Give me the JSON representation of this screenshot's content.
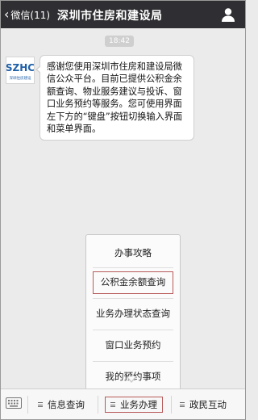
{
  "header": {
    "back_label": "微信(11)",
    "title": "深圳市住房和建设局"
  },
  "chat": {
    "timestamp": "18:42",
    "avatar_logo_text": "SZHC",
    "avatar_sub_text": "深圳住房建设",
    "message": "感谢您使用深圳市住房和建设局微信公众平台。目前已提供公积金余额查询、物业服务建议与投诉、窗口业务预约等服务。您可使用界面左下方的“键盘”按钮切换输入界面和菜单界面。"
  },
  "popup_menu": {
    "items": [
      {
        "label": "办事攻略",
        "highlighted": false
      },
      {
        "label": "公积金余额查询",
        "highlighted": true
      },
      {
        "label": "业务办理状态查询",
        "highlighted": false
      },
      {
        "label": "窗口业务预约",
        "highlighted": false
      },
      {
        "label": "我的预约事项",
        "highlighted": false
      }
    ]
  },
  "bottom_bar": {
    "tabs": [
      {
        "label": "信息查询",
        "highlighted": false
      },
      {
        "label": "业务办理",
        "highlighted": true
      },
      {
        "label": "政民互动",
        "highlighted": false
      }
    ]
  },
  "colors": {
    "header_bg": "#2f2f33",
    "highlight_border": "#b85a5a",
    "logo_blue": "#1f5fa8"
  }
}
